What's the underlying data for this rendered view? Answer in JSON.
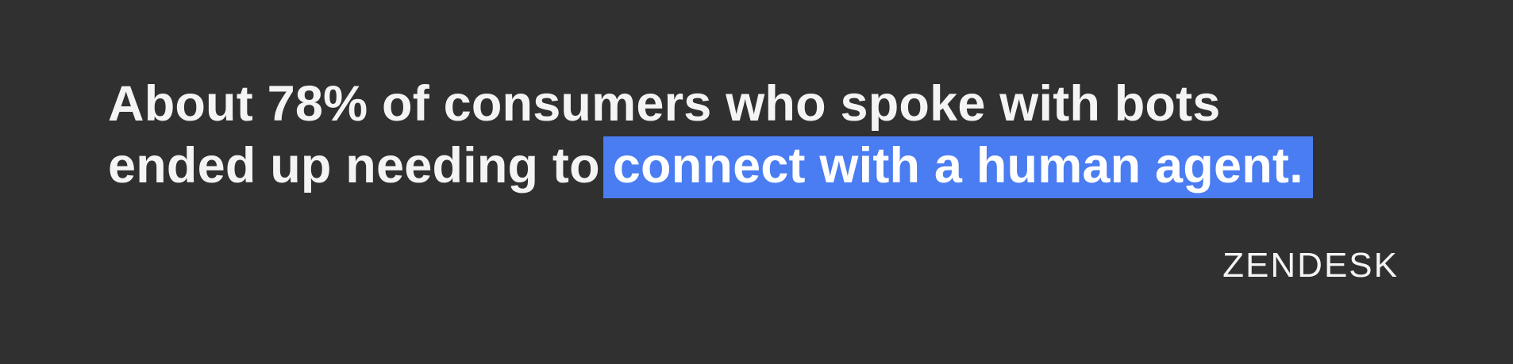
{
  "quote": {
    "line1": "About 78% of consumers who spoke with bots",
    "line2_plain": "ended up needing to",
    "line2_highlight": "connect with a human agent."
  },
  "brand": {
    "name": "ZENDESK"
  },
  "colors": {
    "background": "#303030",
    "text": "#f4f4f4",
    "highlight": "#4a7cf2"
  }
}
